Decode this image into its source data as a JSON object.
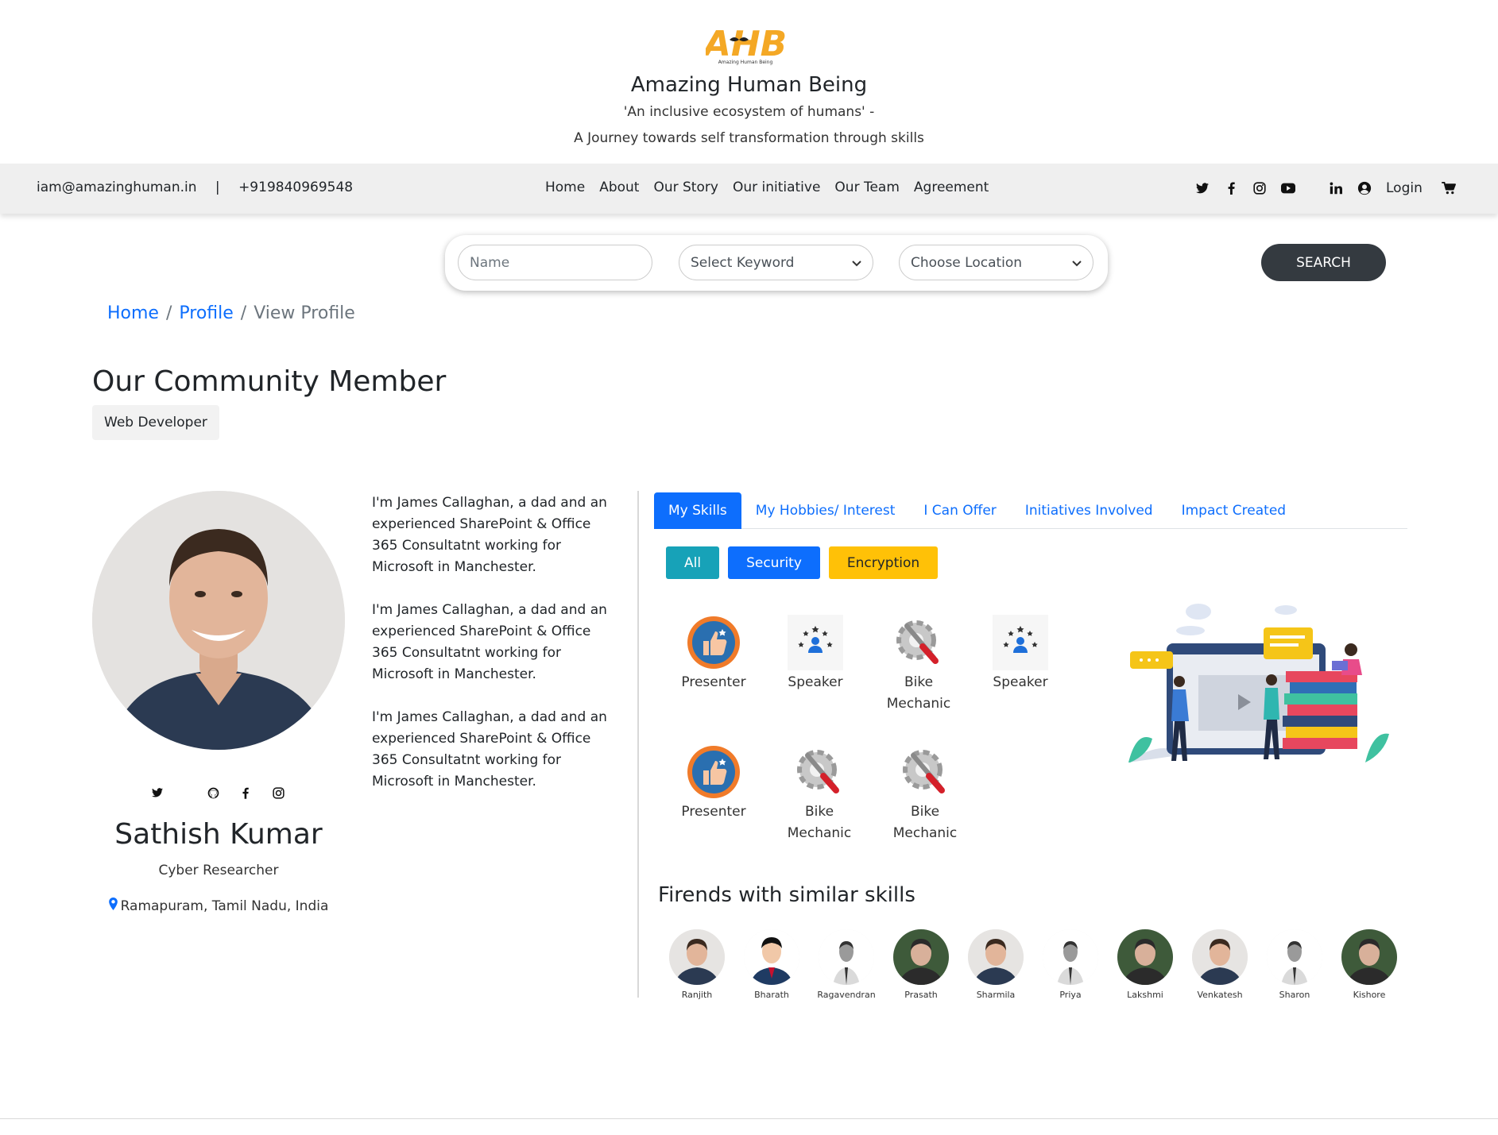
{
  "header": {
    "logo_text": "AHB",
    "logo_caption": "Amazing Human Being",
    "site_title": "Amazing Human Being",
    "tagline_1": "'An inclusive ecosystem of humans' -",
    "tagline_2": "A Journey towards self transformation through skills"
  },
  "topbar": {
    "email": "iam@amazinghuman.in",
    "separator": "|",
    "phone": "+919840969548",
    "nav": [
      "Home",
      "About",
      "Our Story",
      "Our initiative",
      "Our Team",
      "Agreement"
    ],
    "social_icons": [
      "twitter-icon",
      "facebook-icon",
      "instagram-icon",
      "youtube-icon",
      "linkedin-icon",
      "user-circle-icon"
    ],
    "login_label": "Login",
    "cart_icon": "cart-icon"
  },
  "search": {
    "name_placeholder": "Name",
    "keyword_select": "Select Keyword",
    "location_select": "Choose Location",
    "button_label": "SEARCH"
  },
  "breadcrumb": {
    "home": "Home",
    "profile": "Profile",
    "current": "View Profile"
  },
  "page": {
    "title": "Our Community Member",
    "badge": "Web Developer"
  },
  "profile": {
    "name": "Sathish Kumar",
    "role": "Cyber Researcher",
    "location": "Ramapuram, Tamil Nadu, India",
    "social_icons": [
      "twitter-icon",
      "github-icon",
      "facebook-icon",
      "instagram-icon"
    ],
    "bio": [
      "I'm James Callaghan, a dad and an experienced SharePoint & Office 365 Consultatnt working for Microsoft in Manchester.",
      "I'm James Callaghan, a dad and an experienced SharePoint & Office 365 Consultatnt working for Microsoft in Manchester.",
      "I'm James Callaghan, a dad and an experienced SharePoint & Office 365 Consultatnt working for Microsoft in Manchester."
    ]
  },
  "tabs": [
    "My Skills",
    "My Hobbies/ Interest",
    "I Can Offer",
    "Initiatives Involved",
    "Impact Created"
  ],
  "active_tab": "My Skills",
  "filters": [
    "All",
    "Security",
    "Encryption"
  ],
  "skills": [
    {
      "label": "Presenter",
      "icon": "thumbs-up-icon"
    },
    {
      "label": "Speaker",
      "icon": "speaker-stars-icon"
    },
    {
      "label": "Bike Mechanic",
      "icon": "wrench-gear-icon"
    },
    {
      "label": "Speaker",
      "icon": "speaker-stars-icon"
    },
    {
      "label": "Presenter",
      "icon": "thumbs-up-icon"
    },
    {
      "label": "Bike Mechanic",
      "icon": "wrench-gear-icon"
    },
    {
      "label": "Bike Mechanic",
      "icon": "wrench-gear-icon"
    }
  ],
  "friends_title": "Firends with similar skills",
  "friends": [
    "Ranjith",
    "Bharath",
    "Ragavendran",
    "Prasath",
    "Sharmila",
    "Priya",
    "Lakshmi",
    "Venkatesh",
    "Sharon",
    "Kishore"
  ],
  "colors": {
    "primary": "#0d6efd",
    "info": "#17a2b8",
    "warning": "#ffc107",
    "dark_button": "#343a40",
    "topbar_bg": "#efefef",
    "logo_orange": "#f4a825"
  }
}
